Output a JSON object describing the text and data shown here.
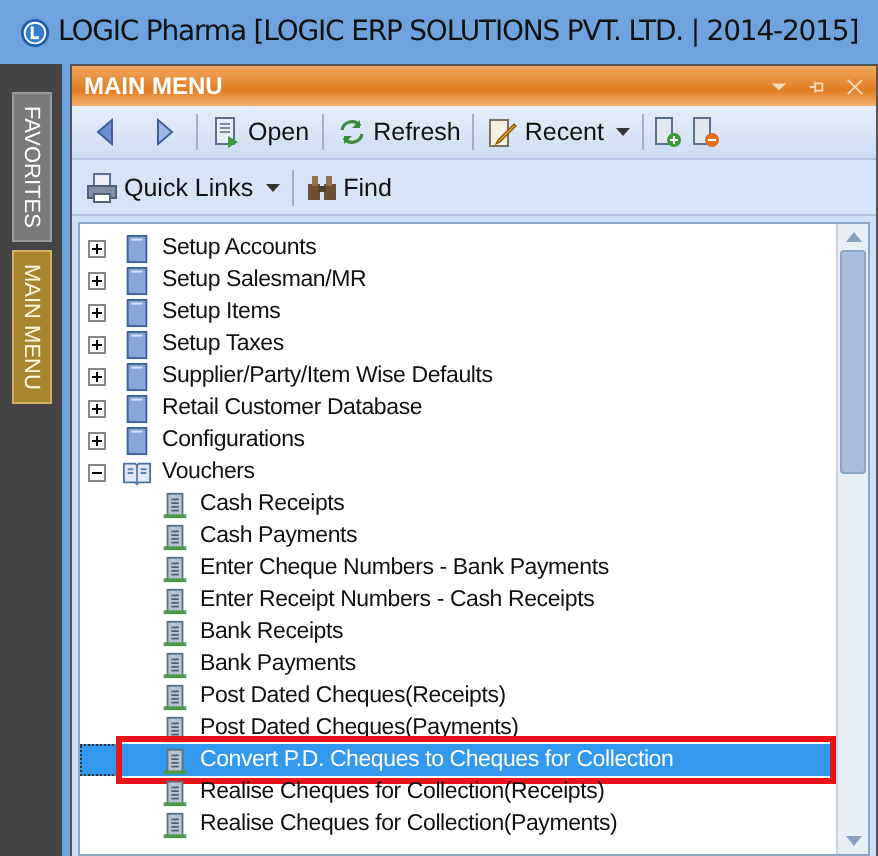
{
  "window": {
    "title": "LOGIC Pharma [LOGIC ERP SOLUTIONS PVT. LTD. | 2014-2015]"
  },
  "side_tabs": [
    {
      "label": "FAVORITES",
      "selected": false
    },
    {
      "label": "MAIN MENU",
      "selected": true
    }
  ],
  "panel": {
    "title": "MAIN MENU"
  },
  "toolbar": [
    {
      "kind": "back"
    },
    {
      "kind": "forward"
    },
    {
      "kind": "separator"
    },
    {
      "kind": "open",
      "label": "Open",
      "dropdown": false
    },
    {
      "kind": "separator"
    },
    {
      "kind": "refresh",
      "label": "Refresh",
      "dropdown": false
    },
    {
      "kind": "separator"
    },
    {
      "kind": "recent",
      "label": "Recent",
      "dropdown": true
    },
    {
      "kind": "separator"
    },
    {
      "kind": "add"
    },
    {
      "kind": "remove"
    }
  ],
  "toolbar2": [
    {
      "kind": "links",
      "label": "Quick Links",
      "dropdown": true
    },
    {
      "kind": "separator"
    },
    {
      "kind": "find",
      "label": "Find",
      "dropdown": false
    }
  ],
  "tree": [
    {
      "label": "Setup Accounts",
      "expanded": false,
      "selected": false
    },
    {
      "label": "Setup Salesman/MR",
      "expanded": false,
      "selected": false
    },
    {
      "label": "Setup Items",
      "expanded": false,
      "selected": false
    },
    {
      "label": "Setup Taxes",
      "expanded": false,
      "selected": false
    },
    {
      "label": "Supplier/Party/Item Wise Defaults",
      "expanded": false,
      "selected": false
    },
    {
      "label": "Retail Customer Database",
      "expanded": false,
      "selected": false
    },
    {
      "label": "Configurations",
      "expanded": false,
      "selected": false
    },
    {
      "label": "Vouchers",
      "expanded": true,
      "selected": false,
      "children": [
        {
          "label": "Cash Receipts",
          "selected": false,
          "highlighted": false
        },
        {
          "label": "Cash Payments",
          "selected": false,
          "highlighted": false
        },
        {
          "label": "Enter Cheque Numbers - Bank Payments",
          "selected": false,
          "highlighted": false
        },
        {
          "label": "Enter Receipt Numbers - Cash Receipts",
          "selected": false,
          "highlighted": false
        },
        {
          "label": "Bank Receipts",
          "selected": false,
          "highlighted": false
        },
        {
          "label": "Bank Payments",
          "selected": false,
          "highlighted": false
        },
        {
          "label": "Post Dated Cheques(Receipts)",
          "selected": false,
          "highlighted": false
        },
        {
          "label": "Post Dated Cheques(Payments)",
          "selected": false,
          "highlighted": false
        },
        {
          "label": "Convert P.D. Cheques to Cheques for Collection",
          "selected": true,
          "highlighted": true
        },
        {
          "label": "Realise Cheques for Collection(Receipts)",
          "selected": false,
          "highlighted": false
        },
        {
          "label": "Realise Cheques for Collection(Payments)",
          "selected": false,
          "highlighted": false
        }
      ]
    }
  ]
}
